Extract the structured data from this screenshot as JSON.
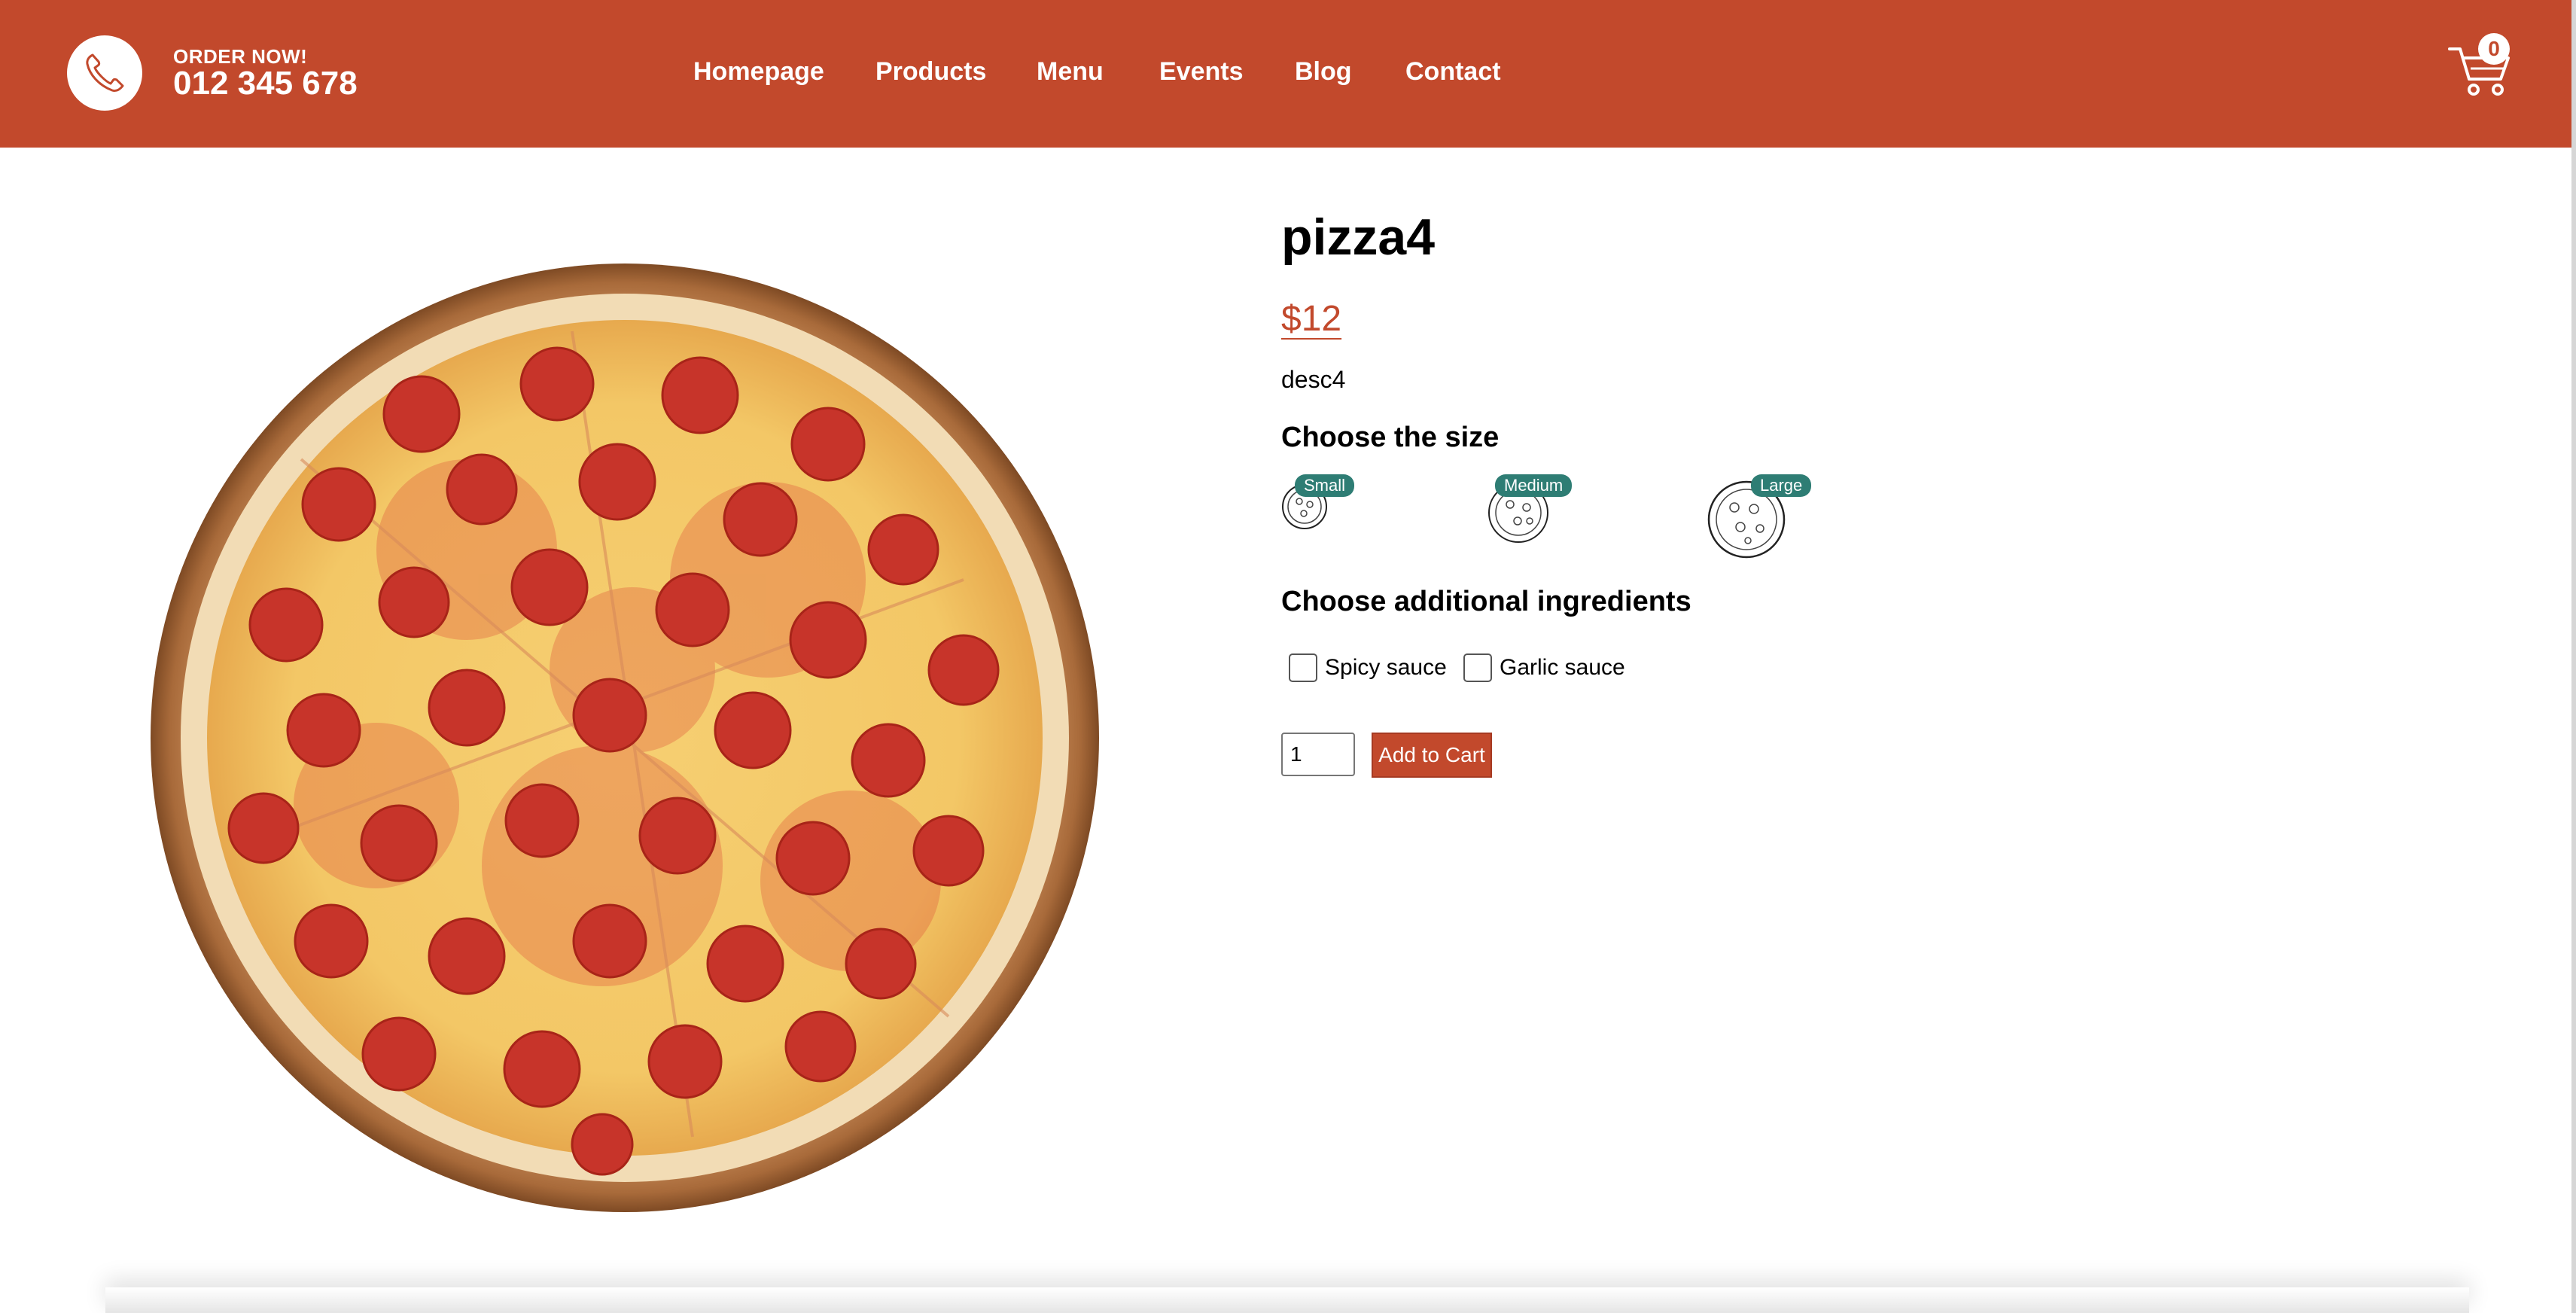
{
  "header": {
    "order_label": "ORDER NOW!",
    "phone_number": "012 345 678",
    "nav": [
      "Homepage",
      "Products",
      "Menu",
      "Events",
      "Blog",
      "Contact"
    ],
    "cart_count": "0"
  },
  "product": {
    "title": "pizza4",
    "price": "$12",
    "description": "desc4",
    "size_heading": "Choose the size",
    "sizes": [
      "Small",
      "Medium",
      "Large"
    ],
    "ingredients_heading": "Choose additional ingredients",
    "ingredients": [
      "Spicy sauce",
      "Garlic sauce"
    ],
    "quantity": "1",
    "add_to_cart_label": "Add to Cart"
  },
  "colors": {
    "brand": "#c2492c",
    "badge": "#2e7d74"
  }
}
